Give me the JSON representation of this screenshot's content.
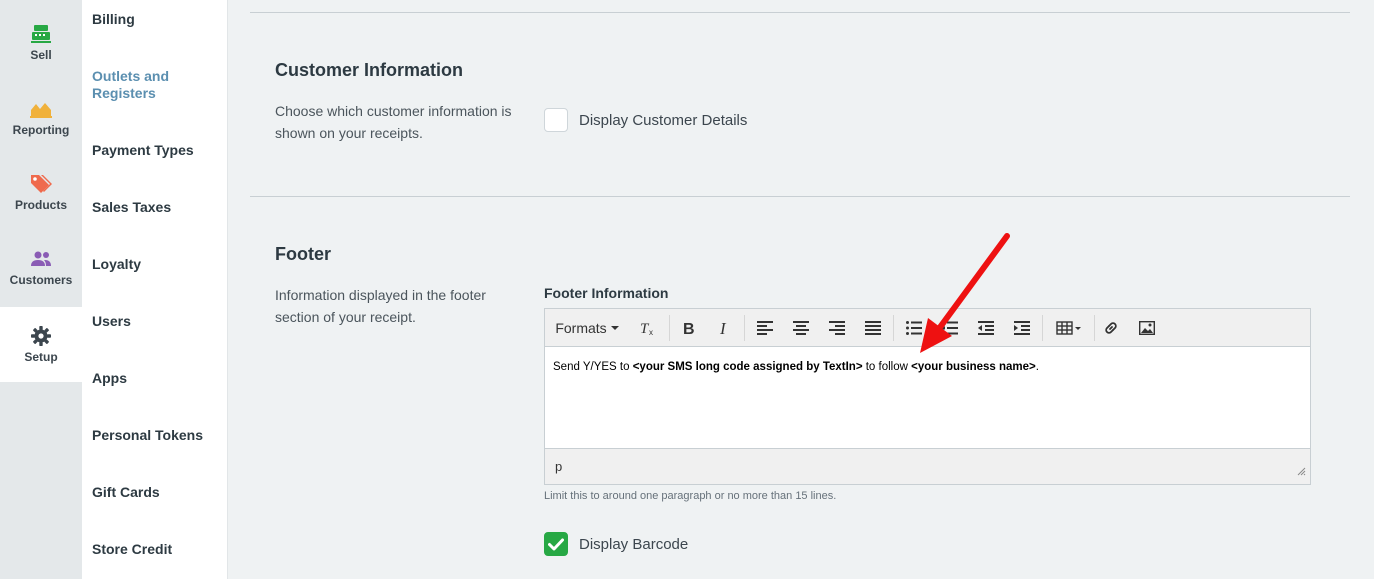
{
  "rail": {
    "items": [
      {
        "label": "Sell",
        "icon": "register-icon",
        "color": "#27a844"
      },
      {
        "label": "Reporting",
        "icon": "chart-area-icon",
        "color": "#f0b13b"
      },
      {
        "label": "Products",
        "icon": "tags-icon",
        "color": "#ef6a4d"
      },
      {
        "label": "Customers",
        "icon": "users-icon",
        "color": "#8a5cb5"
      },
      {
        "label": "Setup",
        "icon": "gear-icon",
        "color": "#3c464e",
        "active": true
      }
    ]
  },
  "menu": {
    "items": [
      {
        "label": "Billing"
      },
      {
        "label": "Outlets and Registers",
        "active": true
      },
      {
        "label": "Payment Types"
      },
      {
        "label": "Sales Taxes"
      },
      {
        "label": "Loyalty"
      },
      {
        "label": "Users"
      },
      {
        "label": "Apps"
      },
      {
        "label": "Personal Tokens"
      },
      {
        "label": "Gift Cards"
      },
      {
        "label": "Store Credit"
      }
    ]
  },
  "customer_info": {
    "title": "Customer Information",
    "description": "Choose which customer information is shown on your receipts.",
    "checkbox_label": "Display Customer Details",
    "checked": false
  },
  "footer": {
    "title": "Footer",
    "description": "Information displayed in the footer section of your receipt.",
    "field_label": "Footer Information",
    "toolbar": {
      "formats_label": "Formats",
      "buttons": [
        "clear-formatting-icon",
        "bold-icon",
        "italic-icon",
        "align-left-icon",
        "align-center-icon",
        "align-right-icon",
        "align-justify-icon",
        "bullet-list-icon",
        "numbered-list-icon",
        "outdent-icon",
        "indent-icon",
        "table-icon",
        "link-icon",
        "image-icon"
      ]
    },
    "content": {
      "part1": "Send Y/YES to ",
      "bold1": "<your SMS long code assigned by TextIn>",
      "part2": " to follow ",
      "bold2": "<your business name>",
      "part3": "."
    },
    "status_path": "p",
    "hint": "Limit this to around one paragraph or no more than 15 lines.",
    "barcode_label": "Display Barcode",
    "barcode_checked": true
  },
  "annotation": {
    "color": "#ee1111"
  }
}
